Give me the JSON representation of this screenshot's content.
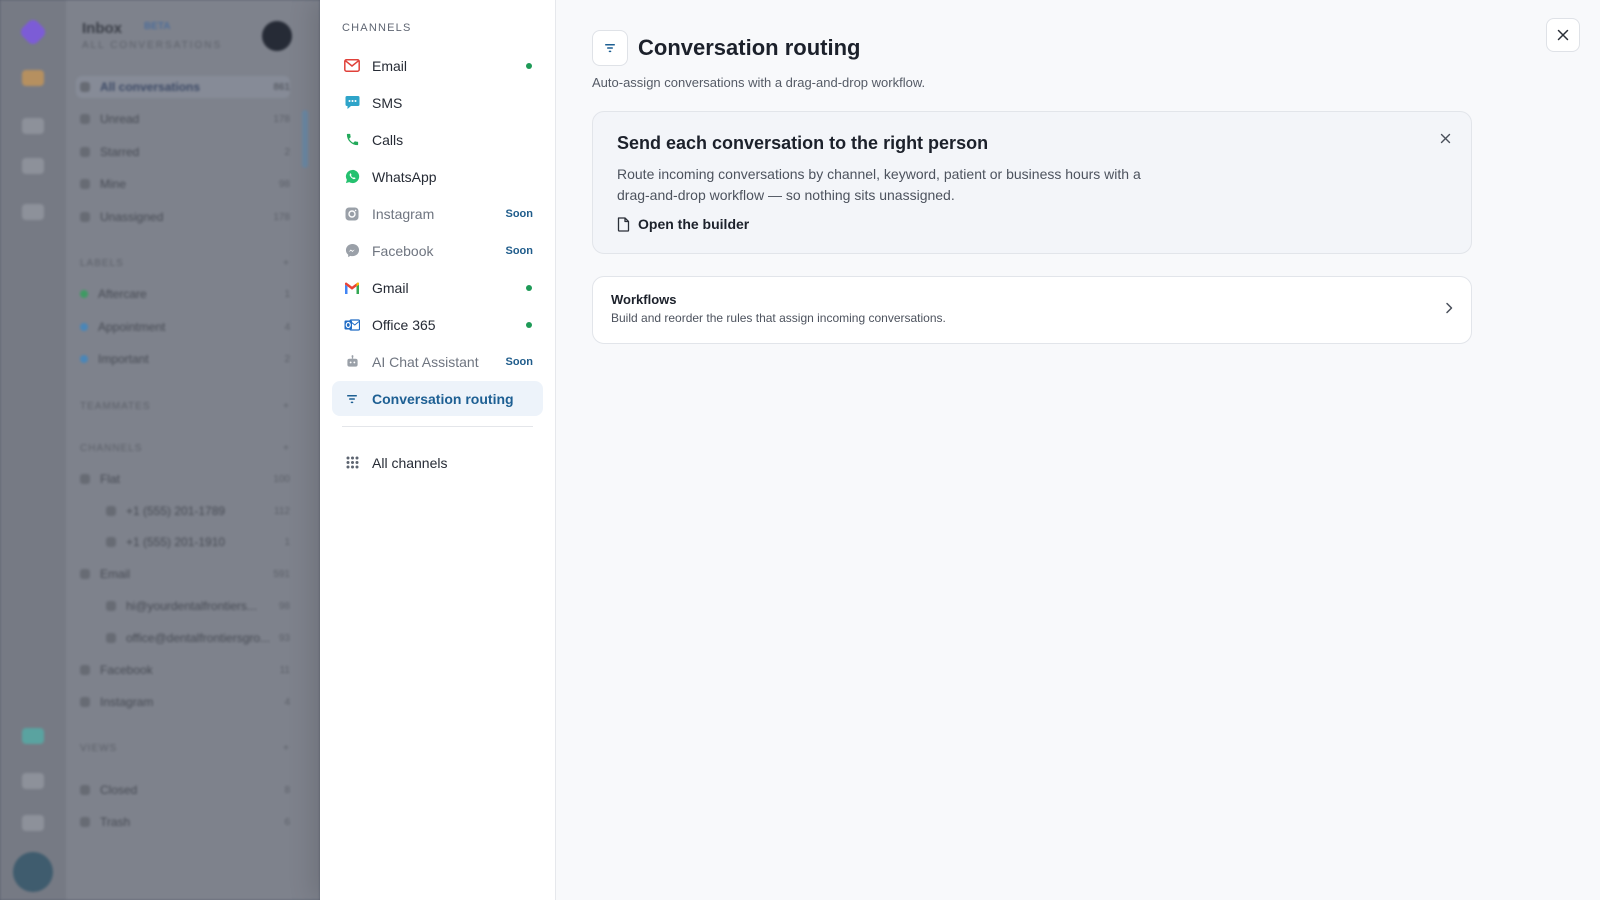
{
  "background_app": {
    "header": {
      "title": "Inbox",
      "badge": "BETA",
      "subtitle": "ALL CONVERSATIONS"
    },
    "rows": [
      {
        "label": "All conversations",
        "count": "861",
        "selected": true
      },
      {
        "label": "Unread",
        "count": "178"
      },
      {
        "label": "Starred",
        "count": "2"
      },
      {
        "label": "Mine",
        "count": "98"
      },
      {
        "label": "Unassigned",
        "count": "178"
      },
      {
        "label": "LABELS",
        "count": "+",
        "section": true
      },
      {
        "label": "Aftercare",
        "count": "1",
        "color": "#3f9a63"
      },
      {
        "label": "Appointment",
        "count": "4",
        "color": "#4a86b8"
      },
      {
        "label": "Important",
        "count": "2",
        "color": "#4a86b8"
      },
      {
        "label": "TEAMMATES",
        "count": "+",
        "section": true
      },
      {
        "label": "CHANNELS",
        "count": "+",
        "section": true
      },
      {
        "label": "Flat",
        "count": "100"
      },
      {
        "label": "+1 (555) 201-1789",
        "count": "112",
        "indent": true
      },
      {
        "label": "+1 (555) 201-1910",
        "count": "1",
        "indent": true
      },
      {
        "label": "Email",
        "count": "591"
      },
      {
        "label": "hi@yourdentalfrontiers...",
        "count": "98",
        "indent": true
      },
      {
        "label": "office@dentalfrontiersgro...",
        "count": "93",
        "indent": true
      },
      {
        "label": "Facebook",
        "count": "11"
      },
      {
        "label": "Instagram",
        "count": "4"
      },
      {
        "label": "VIEWS",
        "count": "+",
        "section": true
      },
      {
        "label": "Closed",
        "count": "8"
      },
      {
        "label": "Trash",
        "count": "6"
      }
    ]
  },
  "nav": {
    "heading": "CHANNELS",
    "items": [
      {
        "label": "Email",
        "icon": "mail-icon",
        "status": "connected"
      },
      {
        "label": "SMS",
        "icon": "sms-icon"
      },
      {
        "label": "Calls",
        "icon": "phone-icon"
      },
      {
        "label": "WhatsApp",
        "icon": "whatsapp-icon"
      },
      {
        "label": "Instagram",
        "icon": "instagram-icon",
        "badge": "Soon"
      },
      {
        "label": "Facebook",
        "icon": "messenger-icon",
        "badge": "Soon"
      },
      {
        "label": "Gmail",
        "icon": "gmail-icon",
        "status": "connected"
      },
      {
        "label": "Office 365",
        "icon": "outlook-icon",
        "status": "connected"
      },
      {
        "label": "AI Chat Assistant",
        "icon": "robot-icon",
        "badge": "Soon"
      },
      {
        "label": "Conversation routing",
        "icon": "filter-icon",
        "active": true
      }
    ],
    "all_channels": {
      "label": "All channels",
      "icon": "grid-icon"
    }
  },
  "main": {
    "title": "Conversation routing",
    "title_icon": "filter-icon",
    "subtitle": "Auto-assign conversations with a drag-and-drop workflow.",
    "banner": {
      "title": "Send each conversation to the right person",
      "text": "Route incoming conversations by channel, keyword, patient or business hours with a drag-and-drop workflow — so nothing sits unassigned.",
      "link_label": "Open the builder"
    },
    "workflows_card": {
      "title": "Workflows",
      "description": "Build and reorder the rules that assign incoming conversations."
    }
  },
  "colors": {
    "accent": "#1d5f93",
    "active_bg": "#edf3fa",
    "connected": "#1e9a57",
    "soon": "#1f5c8b"
  }
}
